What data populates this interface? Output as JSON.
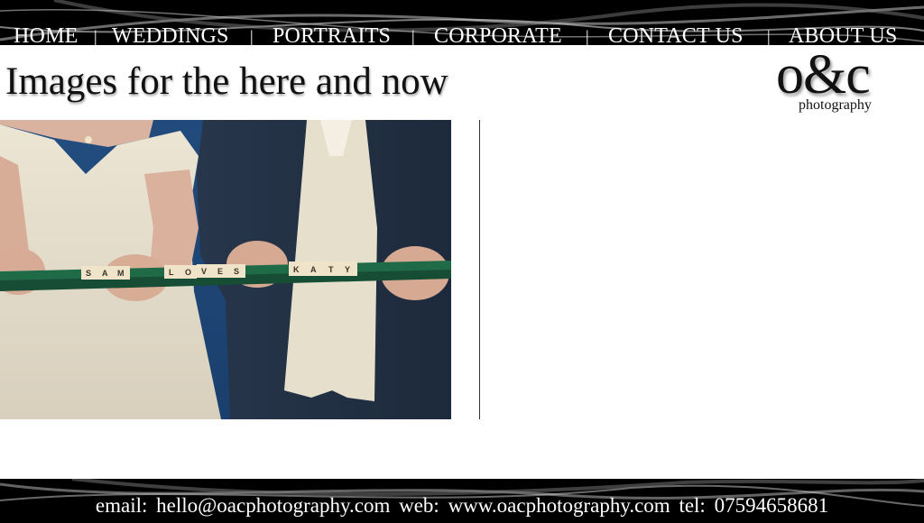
{
  "nav": {
    "items": [
      "HOME",
      "WEDDINGS",
      "PORTRAITS",
      "CORPORATE",
      "CONTACT US",
      "ABOUT US"
    ],
    "separator": "|"
  },
  "headline": "Images for the here and now",
  "logo": {
    "mark": "o&c",
    "sub": "photography"
  },
  "photo": {
    "tiles": [
      "S",
      "A",
      "M",
      "L",
      "O",
      "V",
      "E",
      "S",
      "K",
      "A",
      "T",
      "Y"
    ]
  },
  "footer": {
    "email_label": "email:",
    "email": "hello@oacphotography.com",
    "web_label": "web:",
    "web": "www.oacphotography.com",
    "tel_label": "tel:",
    "tel": "07594658681"
  },
  "colors": {
    "bar": "#000000",
    "backdrop": "#1f4a7e",
    "rack": "#1f6b48"
  }
}
